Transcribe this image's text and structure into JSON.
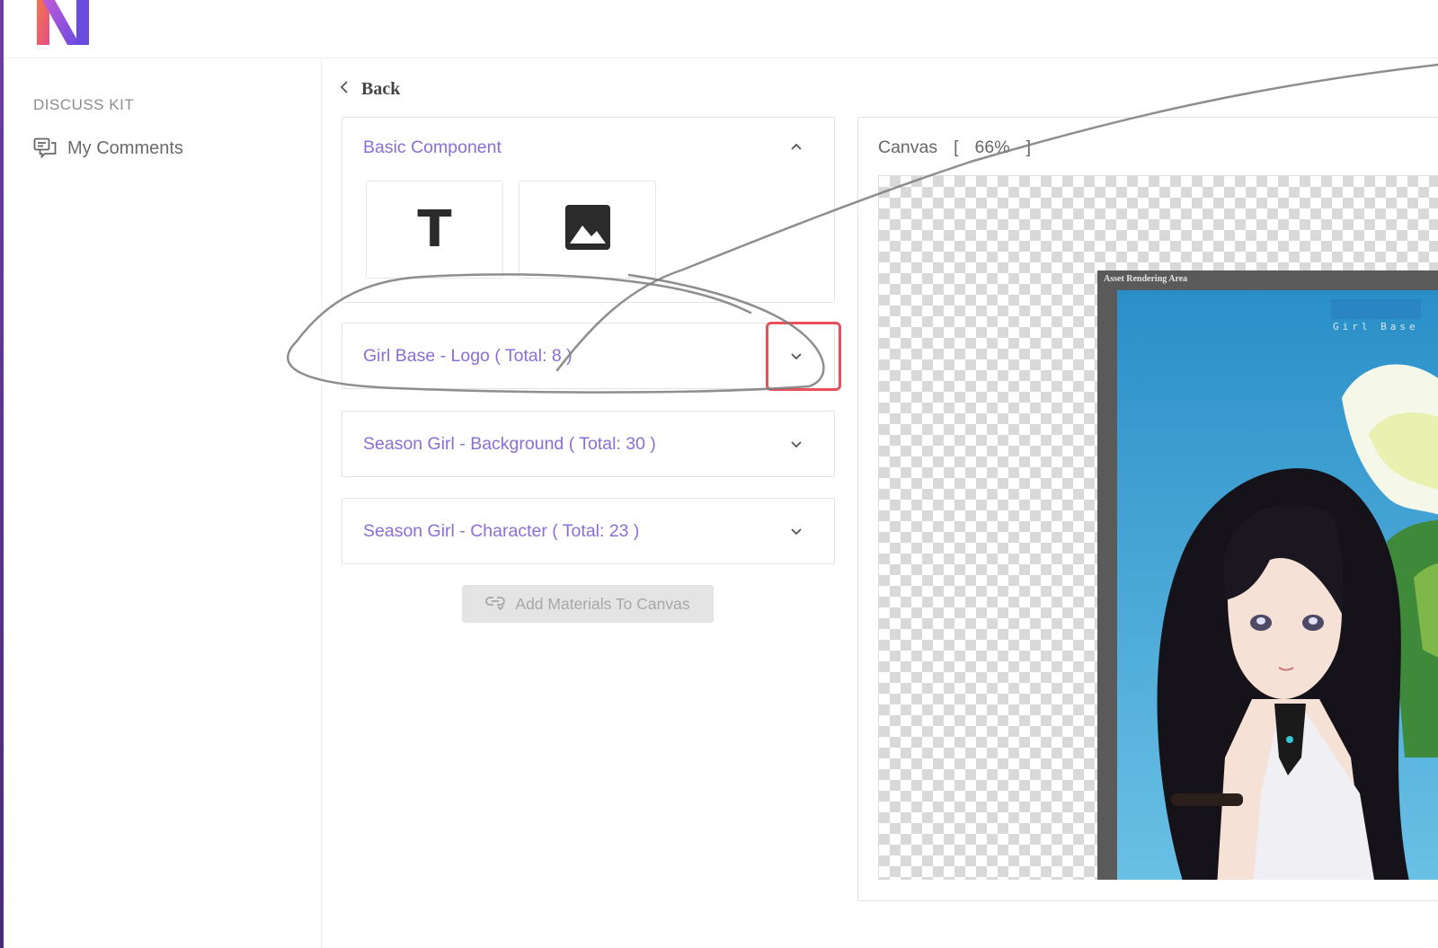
{
  "sidebar": {
    "heading": "DISCUSS KIT",
    "items": [
      {
        "label": "My Comments",
        "icon": "comments-icon"
      }
    ]
  },
  "main": {
    "back_label": "Back",
    "panels": [
      {
        "title": "Basic Component",
        "expanded": true,
        "tools": [
          {
            "name": "text-tool",
            "glyph": "T"
          },
          {
            "name": "image-tool",
            "icon": "image-icon"
          }
        ]
      },
      {
        "title": "Girl Base - Logo ( Total: 8 )",
        "expanded": false
      },
      {
        "title": "Season Girl - Background ( Total: 30 )",
        "expanded": false
      },
      {
        "title": "Season Girl - Character ( Total: 23 )",
        "expanded": false
      }
    ],
    "add_button_label": "Add Materials To Canvas"
  },
  "canvas": {
    "label": "Canvas",
    "zoom_open": "[",
    "zoom": "66%",
    "zoom_close": "]",
    "render_area_label": "Asset Rendering Area",
    "preview_watermark": "Girl Base"
  },
  "colors": {
    "accent": "#8a6ed6",
    "highlight": "#e8505b",
    "disabled_bg": "#e4e4e4"
  }
}
